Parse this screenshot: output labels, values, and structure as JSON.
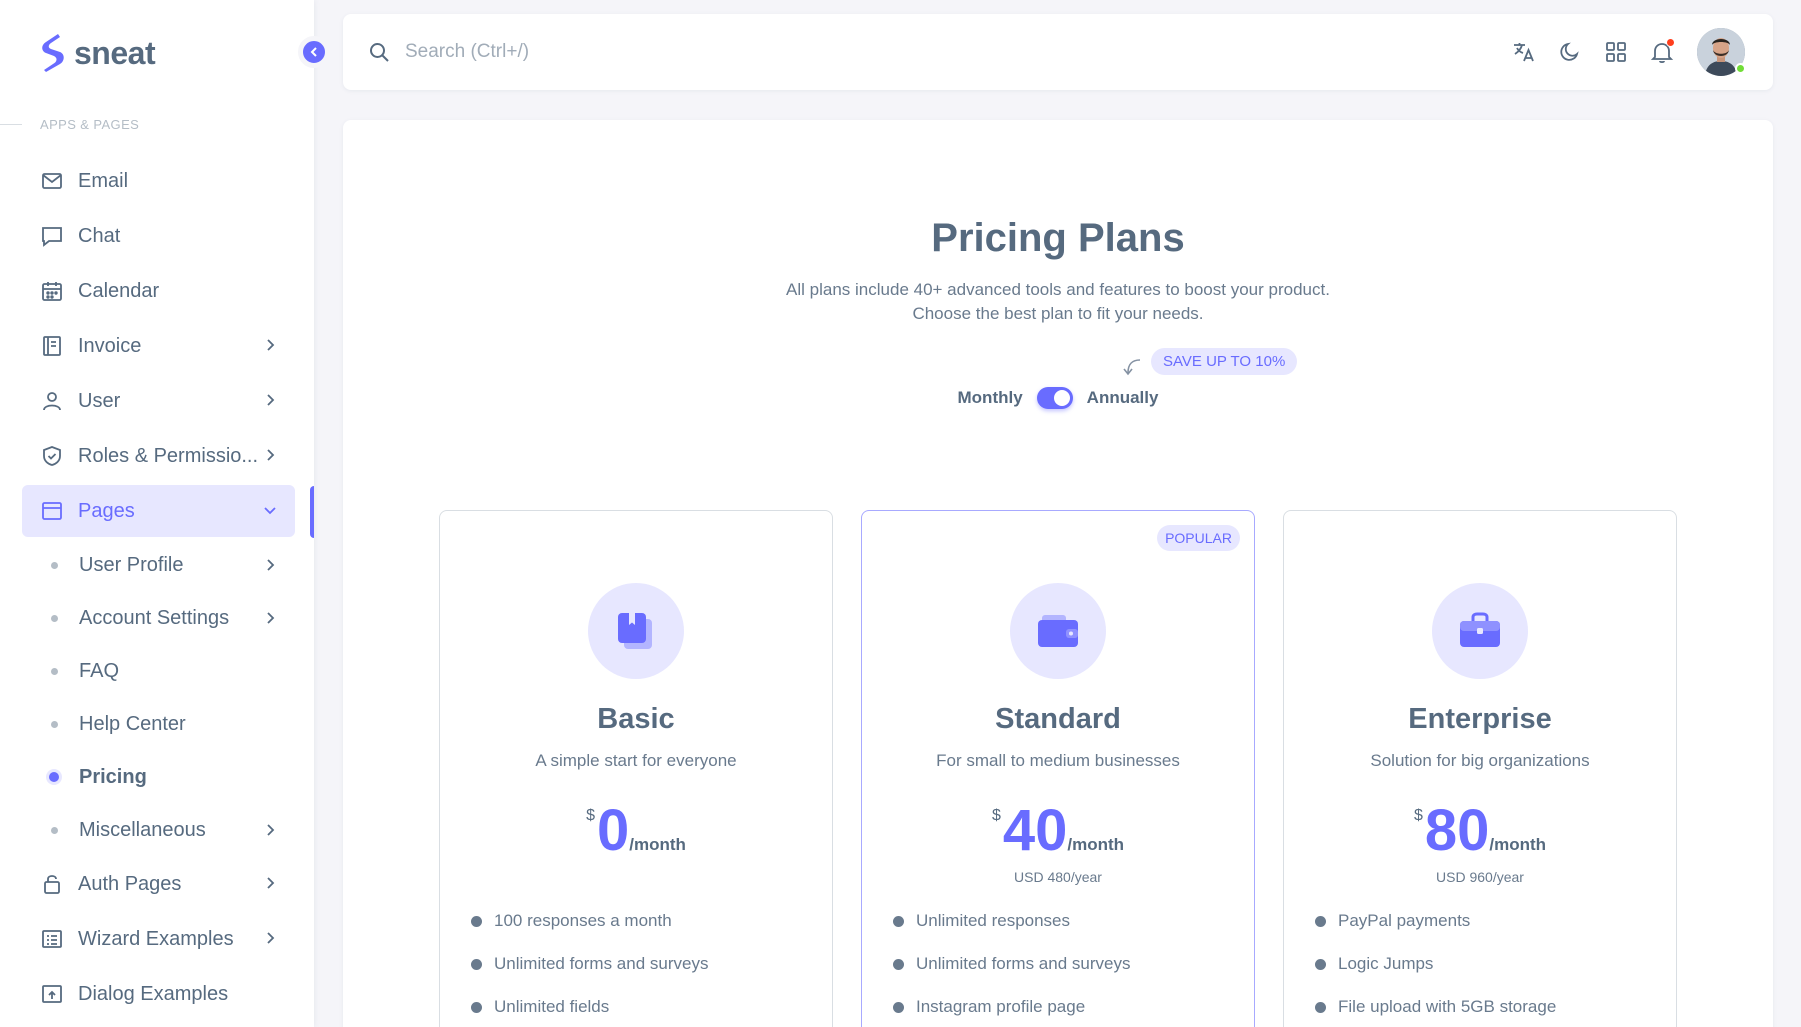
{
  "brand": {
    "name": "sneat"
  },
  "sidebar": {
    "section_header": "APPS & PAGES",
    "items": [
      {
        "label": "Email",
        "icon": "mail-icon"
      },
      {
        "label": "Chat",
        "icon": "chat-icon"
      },
      {
        "label": "Calendar",
        "icon": "calendar-icon"
      },
      {
        "label": "Invoice",
        "icon": "invoice-icon"
      },
      {
        "label": "User",
        "icon": "user-icon"
      },
      {
        "label": "Roles & Permissio...",
        "icon": "shield-check-icon"
      },
      {
        "label": "Pages",
        "icon": "window-icon"
      }
    ],
    "pages_submenu": [
      {
        "label": "User Profile"
      },
      {
        "label": "Account Settings"
      },
      {
        "label": "FAQ"
      },
      {
        "label": "Help Center"
      },
      {
        "label": "Pricing"
      },
      {
        "label": "Miscellaneous"
      }
    ],
    "more_items": [
      {
        "label": "Auth Pages",
        "icon": "lock-icon"
      },
      {
        "label": "Wizard Examples",
        "icon": "list-icon"
      },
      {
        "label": "Dialog Examples",
        "icon": "dialog-icon"
      }
    ]
  },
  "navbar": {
    "search_placeholder": "Search (Ctrl+/)",
    "icons": [
      "translate-icon",
      "moon-icon",
      "grid-icon",
      "bell-icon"
    ]
  },
  "pricing": {
    "title": "Pricing Plans",
    "subtitle_line1": "All plans include 40+ advanced tools and features to boost your product.",
    "subtitle_line2": "Choose the best plan to fit your needs.",
    "save_badge": "SAVE UP TO 10%",
    "monthly_label": "Monthly",
    "annually_label": "Annually",
    "billing_annual": true,
    "plans": [
      {
        "name": "Basic",
        "description": "A simple start for everyone",
        "currency": "$",
        "price": "0",
        "period": "/month",
        "yearly": "",
        "features": [
          "100 responses a month",
          "Unlimited forms and surveys",
          "Unlimited fields"
        ]
      },
      {
        "name": "Standard",
        "badge": "POPULAR",
        "description": "For small to medium businesses",
        "currency": "$",
        "price": "40",
        "period": "/month",
        "yearly": "USD 480/year",
        "features": [
          "Unlimited responses",
          "Unlimited forms and surveys",
          "Instagram profile page"
        ]
      },
      {
        "name": "Enterprise",
        "description": "Solution for big organizations",
        "currency": "$",
        "price": "80",
        "period": "/month",
        "yearly": "USD 960/year",
        "features": [
          "PayPal payments",
          "Logic Jumps",
          "File upload with 5GB storage"
        ]
      }
    ]
  },
  "colors": {
    "accent": "#696cff",
    "accent_light": "#e7e7ff",
    "text": "#566a7f",
    "background": "#f5f5f9",
    "online": "#71dd37",
    "notification": "#ff3e1d"
  }
}
